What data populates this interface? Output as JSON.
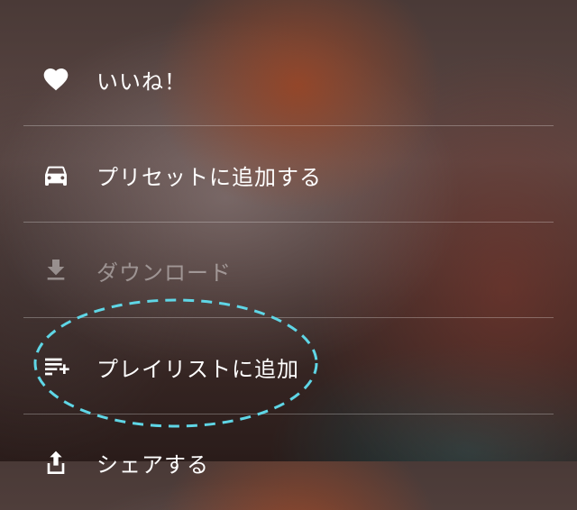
{
  "menu": {
    "items": [
      {
        "label": "いいね！",
        "icon": "heart-icon",
        "enabled": true
      },
      {
        "label": "プリセットに追加する",
        "icon": "car-icon",
        "enabled": true
      },
      {
        "label": "ダウンロード",
        "icon": "download-icon",
        "enabled": false
      },
      {
        "label": "プレイリストに追加",
        "icon": "playlist-add-icon",
        "enabled": true
      },
      {
        "label": "シェアする",
        "icon": "share-icon",
        "enabled": true
      }
    ]
  },
  "colors": {
    "text": "#ffffff",
    "text_disabled": "#8a7f7d",
    "divider": "#7d6f6c",
    "highlight_ring": "#5fd6e6"
  }
}
